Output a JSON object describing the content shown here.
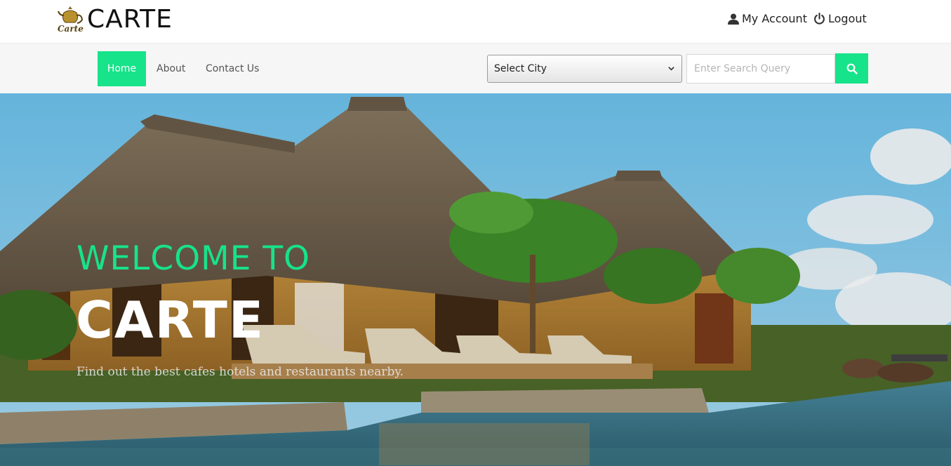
{
  "header": {
    "brand": "CARTE",
    "logo_text": "Carte",
    "account_label": "My Account",
    "logout_label": "Logout"
  },
  "nav": {
    "items": [
      {
        "label": "Home",
        "active": true
      },
      {
        "label": "About",
        "active": false
      },
      {
        "label": "Contact Us",
        "active": false
      }
    ],
    "city_select": {
      "selected": "Select City"
    },
    "search": {
      "placeholder": "Enter Search Query",
      "value": ""
    }
  },
  "hero": {
    "line1": "WELCOME TO",
    "line2": "CARTE",
    "subtitle": "Find out the best cafes hotels and restaurants nearby."
  },
  "colors": {
    "accent": "#17e38a",
    "navbar_bg": "#f6f6f6"
  },
  "icons": {
    "account": "user-icon",
    "logout": "power-icon",
    "search": "search-icon",
    "dropdown": "chevron-down-icon"
  }
}
